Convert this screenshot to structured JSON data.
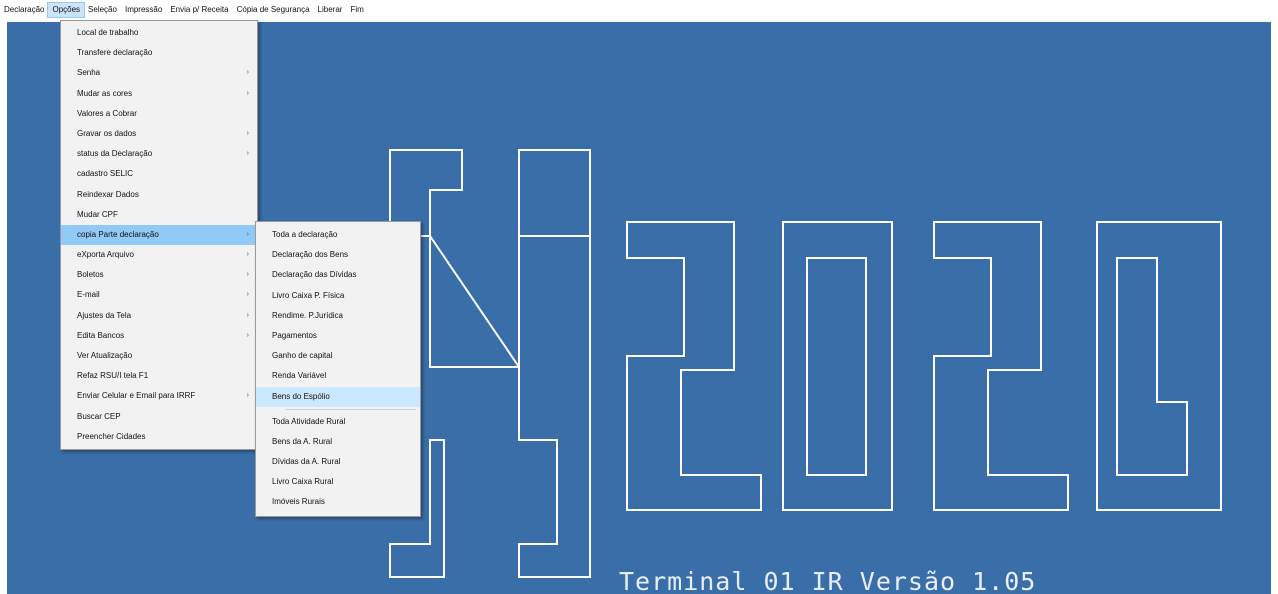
{
  "menubar": [
    "Declaração",
    "Opções",
    "Seleção",
    "Impressão",
    "Envia p/ Receita",
    "Cópia de Segurança",
    "Liberar",
    "Fim"
  ],
  "opcoes_menu": [
    {
      "label": "Local de trabalho",
      "submenu": false
    },
    {
      "label": "Transfere declaração",
      "submenu": false
    },
    {
      "label": "Senha",
      "submenu": true
    },
    {
      "label": "Mudar as cores",
      "submenu": true
    },
    {
      "label": "Valores a Cobrar",
      "submenu": false
    },
    {
      "label": "Gravar os dados",
      "submenu": true
    },
    {
      "label": "status da Declaração",
      "submenu": true
    },
    {
      "label": "cadastro SELIC",
      "submenu": false
    },
    {
      "label": "Reindexar Dados",
      "submenu": false
    },
    {
      "label": "Mudar CPF",
      "submenu": false
    },
    {
      "label": "copia Parte declaração",
      "submenu": true
    },
    {
      "label": "eXporta Arquivo",
      "submenu": true
    },
    {
      "label": "Boletos",
      "submenu": true
    },
    {
      "label": "E-mail",
      "submenu": true
    },
    {
      "label": "Ajustes da Tela",
      "submenu": true
    },
    {
      "label": "Edita Bancos",
      "submenu": true
    },
    {
      "label": "Ver Atualização",
      "submenu": false
    },
    {
      "label": "Refaz RSU/I tela F1",
      "submenu": false
    },
    {
      "label": "Enviar Celular e Email para IRRF",
      "submenu": true
    },
    {
      "label": "Buscar CEP",
      "submenu": false
    },
    {
      "label": "Preencher Cidades",
      "submenu": false
    }
  ],
  "submenu_group1": [
    "Toda a declaração",
    "Declaração dos Bens",
    "Declaração das Dívidas",
    "Livro Caixa P. Física",
    "Rendime. P.Jurídica",
    "Pagamentos",
    "Ganho de capital",
    "Renda Variável",
    "Bens do Espólio"
  ],
  "submenu_group2": [
    "Toda Atividade Rural",
    "Bens da A. Rural",
    "Dívidas da A. Rural",
    "Livro Caixa Rural",
    "Imóveis Rurais"
  ],
  "active_opcao": "copia Parte declaração",
  "highlighted_sub": "Bens do Espólio",
  "terminal_text": "Terminal 01 IR Versão 1.05",
  "colors": {
    "background": "#3a6ea8",
    "logo_stroke": "#ffffff",
    "menu_bg": "#f2f2f2",
    "active_item": "#91c9f7"
  }
}
